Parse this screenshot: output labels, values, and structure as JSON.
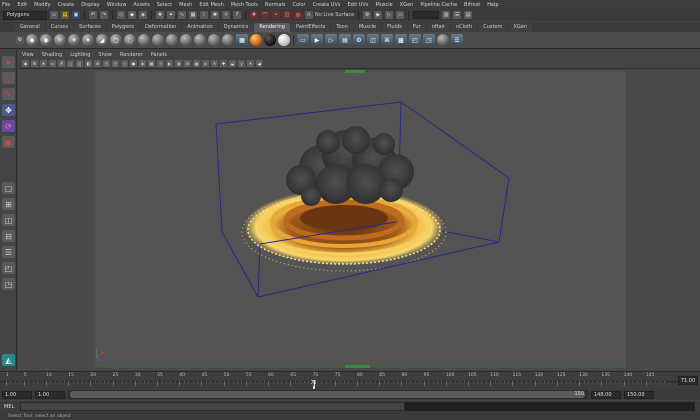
{
  "menubar": {
    "items": [
      "File",
      "Edit",
      "Modify",
      "Create",
      "Display",
      "Window",
      "Assets",
      "Select",
      "Mesh",
      "Edit Mesh",
      "Mesh Tools",
      "Normals",
      "Color",
      "Create UVs",
      "Edit UVs",
      "Muscle",
      "XGen",
      "Pipeline Cache",
      "Bifrost",
      "Help"
    ]
  },
  "statusline": {
    "mode": "Polygons",
    "live_surface": "No Live Surface"
  },
  "shelf_tabs": [
    {
      "label": "General",
      "active": false
    },
    {
      "label": "Curves",
      "active": false
    },
    {
      "label": "Surfaces",
      "active": false
    },
    {
      "label": "Polygons",
      "active": false
    },
    {
      "label": "Deformation",
      "active": false
    },
    {
      "label": "Animation",
      "active": false
    },
    {
      "label": "Dynamics",
      "active": false
    },
    {
      "label": "Rendering",
      "active": true
    },
    {
      "label": "PaintEffects",
      "active": false
    },
    {
      "label": "Toon",
      "active": false
    },
    {
      "label": "Muscle",
      "active": false
    },
    {
      "label": "Fluids",
      "active": false
    },
    {
      "label": "Fur",
      "active": false
    },
    {
      "label": "nHair",
      "active": false
    },
    {
      "label": "nCloth",
      "active": false
    },
    {
      "label": "Custom",
      "active": false
    },
    {
      "label": "XGen",
      "active": false
    }
  ],
  "panel_menu": {
    "items": [
      "View",
      "Shading",
      "Lighting",
      "Show",
      "Renderer",
      "Panels"
    ]
  },
  "timeline": {
    "ticks": [
      "1",
      "5",
      "10",
      "15",
      "20",
      "25",
      "30",
      "35",
      "40",
      "45",
      "50",
      "55",
      "60",
      "65",
      "70",
      "75",
      "80",
      "85",
      "90",
      "95",
      "100",
      "105",
      "110",
      "115",
      "120",
      "125",
      "130",
      "135",
      "140",
      "145"
    ],
    "current_frame": "70",
    "current_time_field": "71.00"
  },
  "range": {
    "start": "1.00",
    "playback_start": "1.00",
    "end_marker": "150",
    "playback_end": "148.00",
    "animation_end": "150.00"
  },
  "command_line": {
    "language": "MEL"
  },
  "help_line": {
    "text": "Select Tool: select an object"
  },
  "colors": {
    "viewport_bg": "#545454",
    "bbox_line": "#2a2a8a",
    "fire_ring": "#f2c14a",
    "smoke": "#3a3a3a",
    "camera_frame": "#2a6a2a"
  }
}
